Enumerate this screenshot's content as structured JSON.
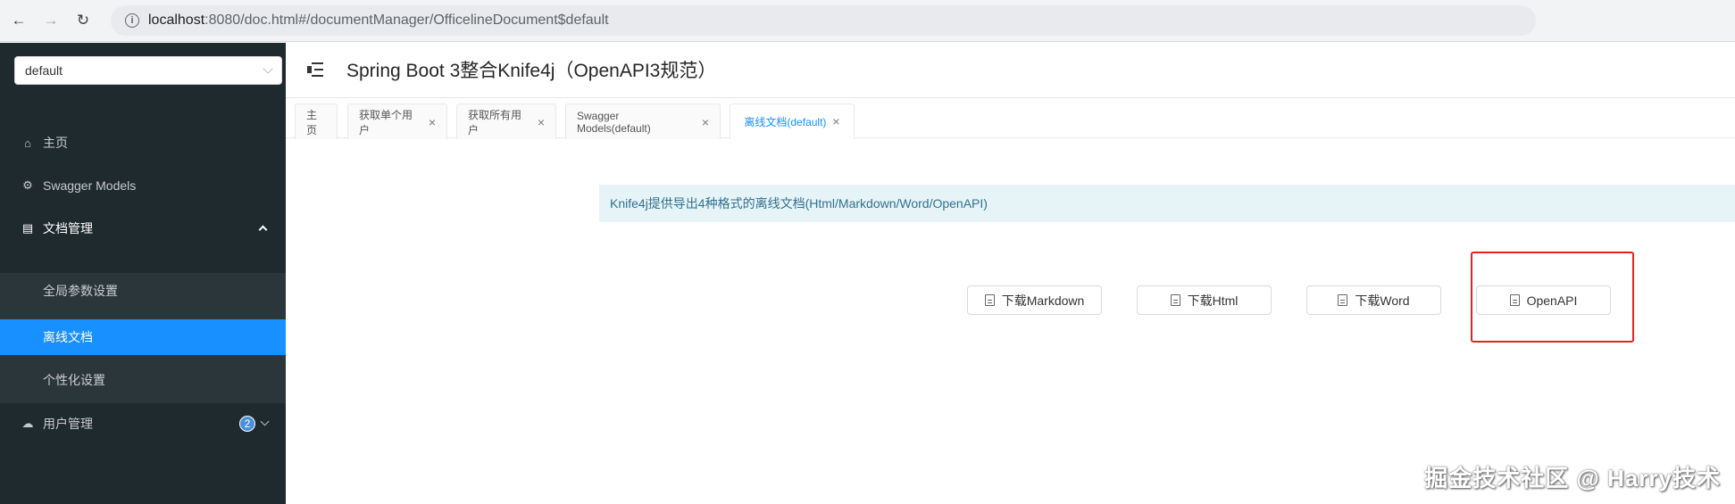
{
  "browser": {
    "url_host": "localhost",
    "url_path": ":8080/doc.html#/documentManager/OfficelineDocument$default"
  },
  "sidebar": {
    "group_select_value": "default",
    "items": [
      {
        "label": "主页",
        "icon": "home-icon"
      },
      {
        "label": "Swagger Models",
        "icon": "gear-icon"
      },
      {
        "label": "文档管理",
        "icon": "doc-manage-icon",
        "expanded": true
      },
      {
        "label": "用户管理",
        "icon": "cloud-icon",
        "badge": "2"
      }
    ],
    "subitems": [
      {
        "label": "全局参数设置"
      },
      {
        "label": "离线文档",
        "active": true
      },
      {
        "label": "个性化设置"
      }
    ]
  },
  "header": {
    "title": "Spring Boot 3整合Knife4j（OpenAPI3规范）"
  },
  "tabs": [
    {
      "label": "主页",
      "closable": false
    },
    {
      "label": "获取单个用户",
      "closable": true
    },
    {
      "label": "获取所有用户",
      "closable": true
    },
    {
      "label": "Swagger Models(default)",
      "closable": true
    },
    {
      "label": "离线文档(default)",
      "closable": true,
      "active": true
    }
  ],
  "content": {
    "notice": "Knife4j提供导出4种格式的离线文档(Html/Markdown/Word/OpenAPI)",
    "buttons": [
      {
        "label": "下载Markdown"
      },
      {
        "label": "下载Html"
      },
      {
        "label": "下载Word"
      },
      {
        "label": "OpenAPI"
      }
    ]
  },
  "watermark": "掘金技术社区 @ Harry技术",
  "colors": {
    "sidebar_bg": "#1f2a2e",
    "active_blue": "#1890ff",
    "highlight_red": "#e32222",
    "notice_bg": "#e6f4f8"
  }
}
